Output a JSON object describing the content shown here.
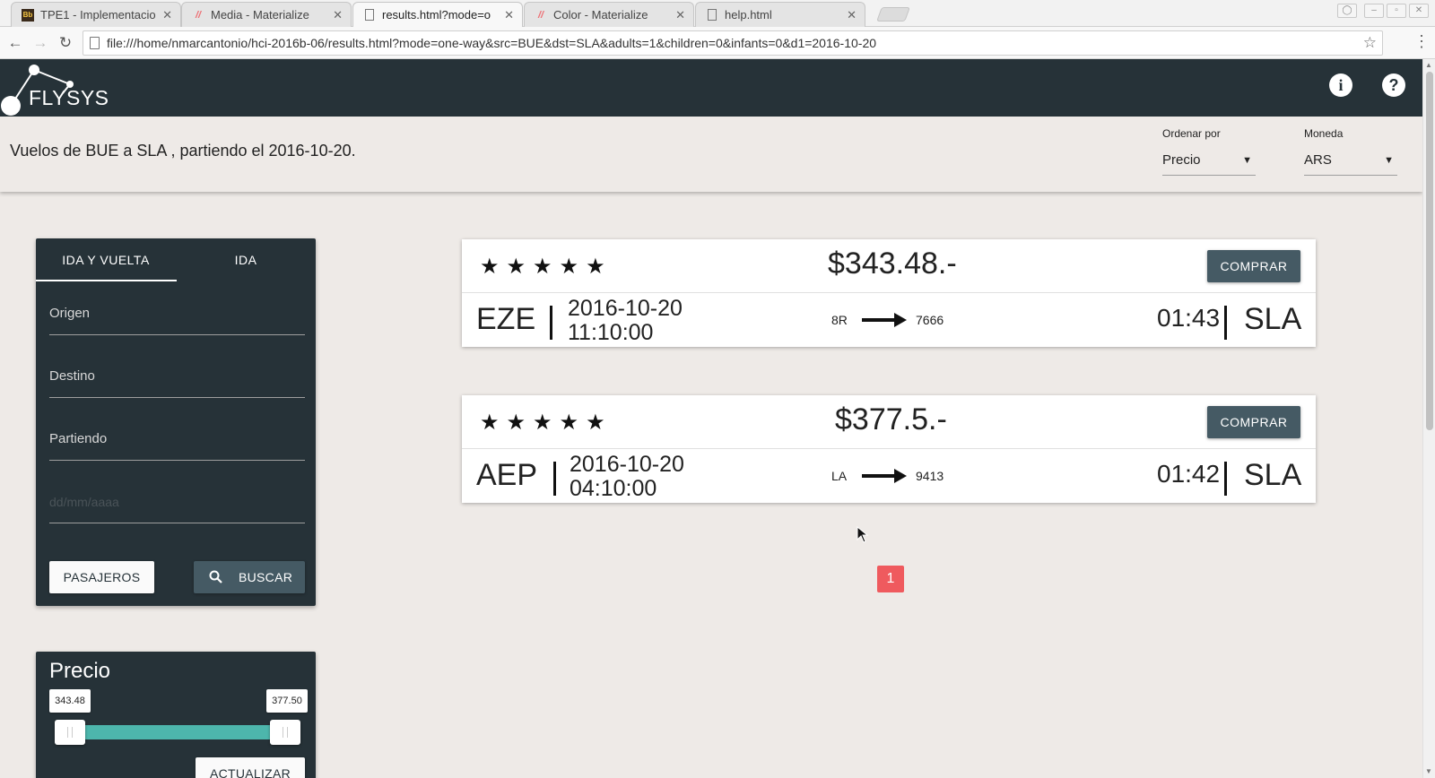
{
  "browser": {
    "tabs": [
      {
        "title": "TPE1 - Implementacio",
        "icon": "blackboard-icon"
      },
      {
        "title": "Media - Materialize",
        "icon": "materialize-icon"
      },
      {
        "title": "results.html?mode=o",
        "icon": "page-icon"
      },
      {
        "title": "Color - Materialize",
        "icon": "materialize-icon"
      },
      {
        "title": "help.html",
        "icon": "page-icon"
      }
    ],
    "url": "file:///home/nmarcantonio/hci-2016b-06/results.html?mode=one-way&src=BUE&dst=SLA&adults=1&children=0&infants=0&d1=2016-10-20"
  },
  "app": {
    "logo_text": "FLYSYS",
    "info_icon": "i",
    "help_icon": "?"
  },
  "subheader": {
    "route_text": "Vuelos de BUE a SLA , partiendo el 2016-10-20.",
    "sort_label": "Ordenar por",
    "sort_value": "Precio",
    "currency_label": "Moneda",
    "currency_value": "ARS"
  },
  "search": {
    "tab_roundtrip": "IDA Y VUELTA",
    "tab_oneway": "IDA",
    "origin_label": "Origen",
    "destination_label": "Destino",
    "departing_label": "Partiendo",
    "date_placeholder": "dd/mm/aaaa",
    "passengers_button": "PASAJEROS",
    "search_button": "BUSCAR"
  },
  "price_filter": {
    "title": "Precio",
    "min": "343.48",
    "max": "377.50",
    "update_button": "ACTUALIZAR"
  },
  "results": [
    {
      "stars": "★★★★★",
      "price": "$343.48.-",
      "buy_label": "COMPRAR",
      "origin": "EZE",
      "date": "2016-10-20",
      "time_dep": "11:10:00",
      "airline": "8R",
      "flight": "7666",
      "duration": "01:43",
      "destination": "SLA"
    },
    {
      "stars": "★★★★★",
      "price": "$377.5.-",
      "buy_label": "COMPRAR",
      "origin": "AEP",
      "date": "2016-10-20",
      "time_dep": "04:10:00",
      "airline": "LA",
      "flight": "9413",
      "duration": "01:42",
      "destination": "SLA"
    }
  ],
  "pagination": {
    "current": "1"
  },
  "colors": {
    "header": "#263238",
    "button": "#455a64",
    "accent": "#4db6ac",
    "page_badge": "#ef5a5e"
  }
}
